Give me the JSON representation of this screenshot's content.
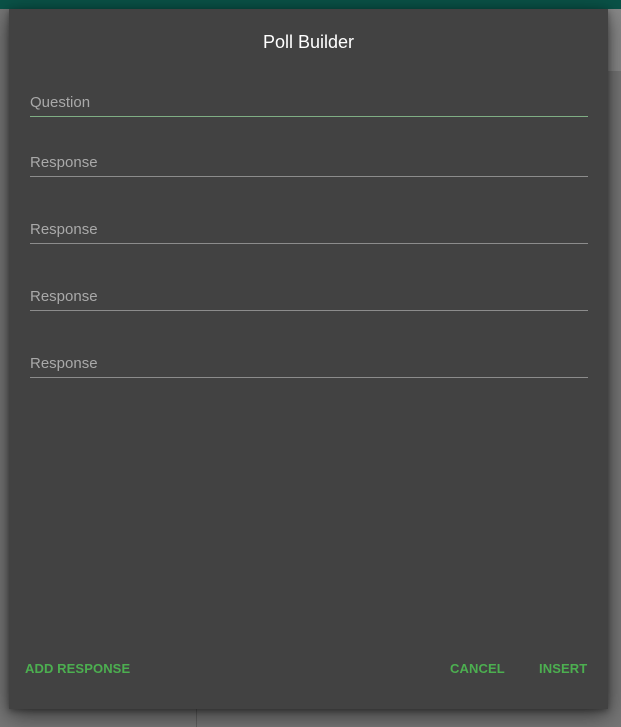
{
  "app": {
    "colors": {
      "top_bar": "#0a5247",
      "dialog_bg": "#424242",
      "accent": "#4caf50",
      "overlay": "#767676"
    }
  },
  "dialog": {
    "title": "Poll Builder",
    "question": {
      "placeholder": "Question",
      "value": ""
    },
    "responses": [
      {
        "placeholder": "Response",
        "value": ""
      },
      {
        "placeholder": "Response",
        "value": ""
      },
      {
        "placeholder": "Response",
        "value": ""
      },
      {
        "placeholder": "Response",
        "value": ""
      }
    ],
    "actions": {
      "add_response": "ADD RESPONSE",
      "cancel": "CANCEL",
      "insert": "INSERT"
    }
  }
}
